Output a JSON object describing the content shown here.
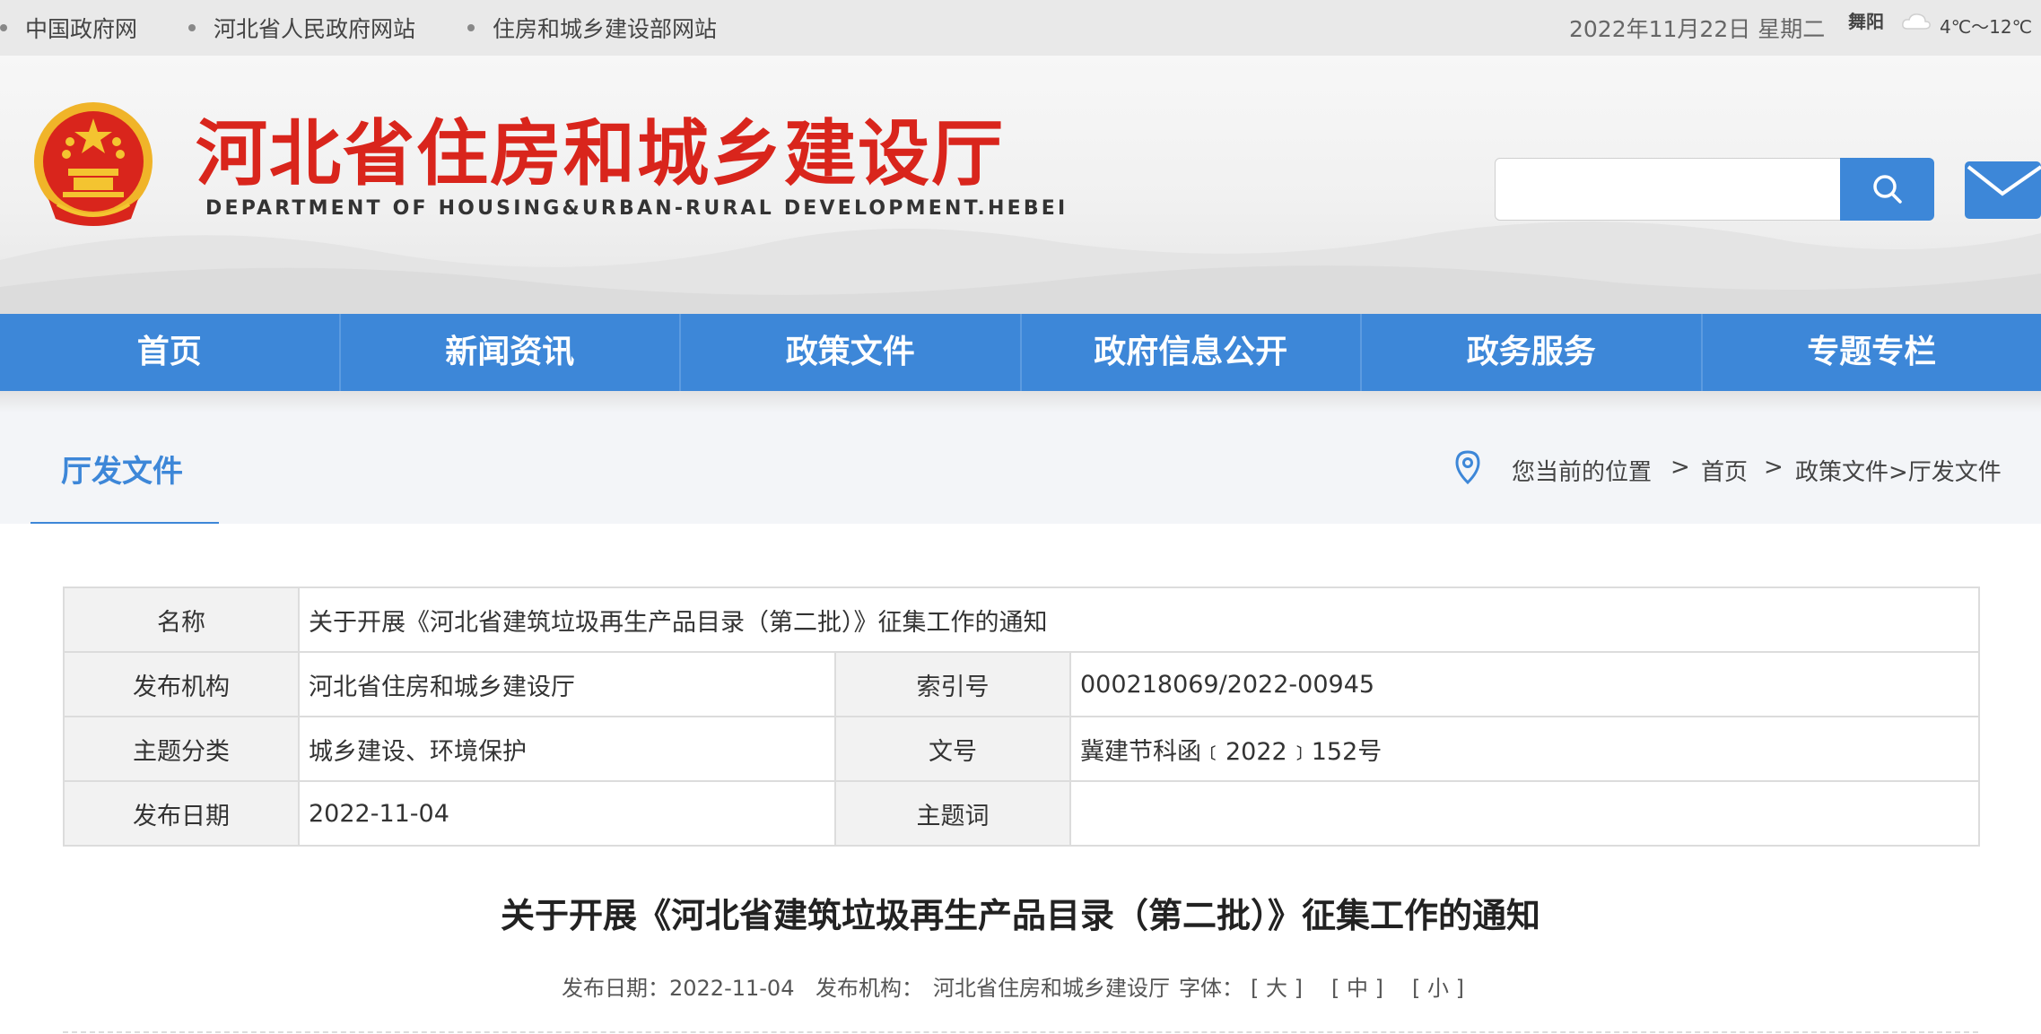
{
  "topbar": {
    "links": [
      "中国政府网",
      "河北省人民政府网站",
      "住房和城乡建设部网站"
    ],
    "date": "2022年11月22日 星期二",
    "weather_city": "舞阳",
    "weather_icon": "cloudy-icon",
    "weather_temp": "4℃～12℃"
  },
  "header": {
    "title": "河北省住房和城乡建设厅",
    "subtitle": "DEPARTMENT OF HOUSING&URBAN-RURAL DEVELOPMENT.HEBEI",
    "search_value": "",
    "emblem_color": "#d9251c"
  },
  "nav": {
    "items": [
      "首页",
      "新闻资讯",
      "政策文件",
      "政府信息公开",
      "政务服务",
      "专题专栏"
    ]
  },
  "section": {
    "title": "厅发文件",
    "breadcrumb": {
      "label": "您当前的位置",
      "sep": ">",
      "home": "首页",
      "path": "政策文件>厅发文件"
    }
  },
  "info": {
    "name_label": "名称",
    "name_value": "关于开展《河北省建筑垃圾再生产品目录（第二批）》征集工作的通知",
    "publisher_label": "发布机构",
    "publisher_value": "河北省住房和城乡建设厅",
    "index_label": "索引号",
    "index_value": "000218069/2022-00945",
    "topic_label": "主题分类",
    "topic_value": "城乡建设、环境保护",
    "docno_label": "文号",
    "docno_value": "冀建节科函﹝2022﹞152号",
    "date_label": "发布日期",
    "date_value": "2022-11-04",
    "keywords_label": "主题词",
    "keywords_value": ""
  },
  "article": {
    "title": "关于开展《河北省建筑垃圾再生产品目录（第二批）》征集工作的通知",
    "meta_date": "发布日期：2022-11-04",
    "meta_publisher_label": "发布机构：",
    "meta_publisher": "河北省住房和城乡建设厅",
    "font_label": "字体：",
    "font_large": "[ 大 ]",
    "font_medium": "[ 中 ]",
    "font_small": "[ 小 ]"
  },
  "colors": {
    "accent": "#3d87d8",
    "brand_red": "#d9251c"
  }
}
